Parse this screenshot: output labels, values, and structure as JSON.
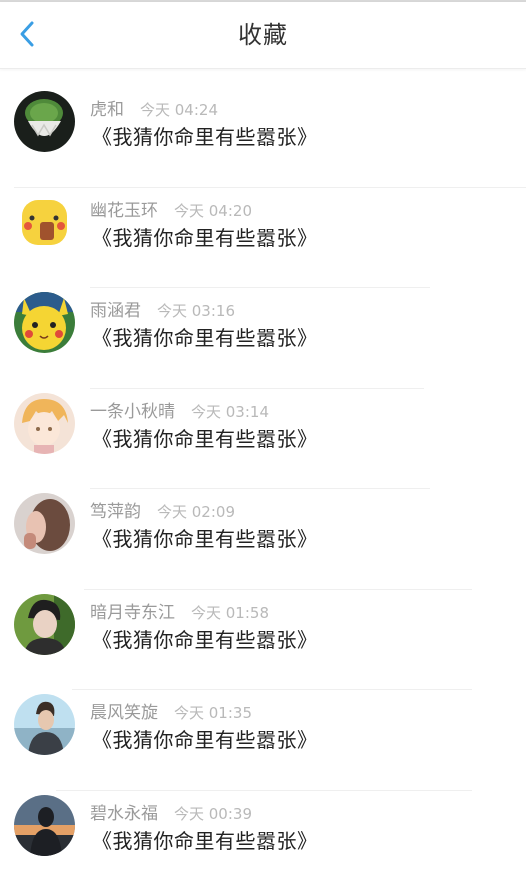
{
  "header": {
    "title": "收藏",
    "back_icon": "chevron-left-icon",
    "accent": "#3a9ee4"
  },
  "items": [
    {
      "name": "虎和",
      "time": "今天 04:24",
      "content": "《我猜你命里有些嚣张》",
      "avatar": "cactus-avatar"
    },
    {
      "name": "幽花玉环",
      "time": "今天 04:20",
      "content": "《我猜你命里有些嚣张》",
      "avatar": "pikachu-face-avatar"
    },
    {
      "name": "雨涵君",
      "time": "今天 03:16",
      "content": "《我猜你命里有些嚣张》",
      "avatar": "pikachu-avatar"
    },
    {
      "name": "一条小秋晴",
      "time": "今天 03:14",
      "content": "《我猜你命里有些嚣张》",
      "avatar": "anime-boy-avatar"
    },
    {
      "name": "笃萍韵",
      "time": "今天 02:09",
      "content": "《我猜你命里有些嚣张》",
      "avatar": "portrait-avatar"
    },
    {
      "name": "暗月寺东江",
      "time": "今天 01:58",
      "content": "《我猜你命里有些嚣张》",
      "avatar": "boy-photo-avatar"
    },
    {
      "name": "晨风笑旋",
      "time": "今天 01:35",
      "content": "《我猜你命里有些嚣张》",
      "avatar": "man-sky-avatar"
    },
    {
      "name": "碧水永福",
      "time": "今天 00:39",
      "content": "《我猜你命里有些嚣张》",
      "avatar": "sunset-silhouette-avatar"
    }
  ]
}
